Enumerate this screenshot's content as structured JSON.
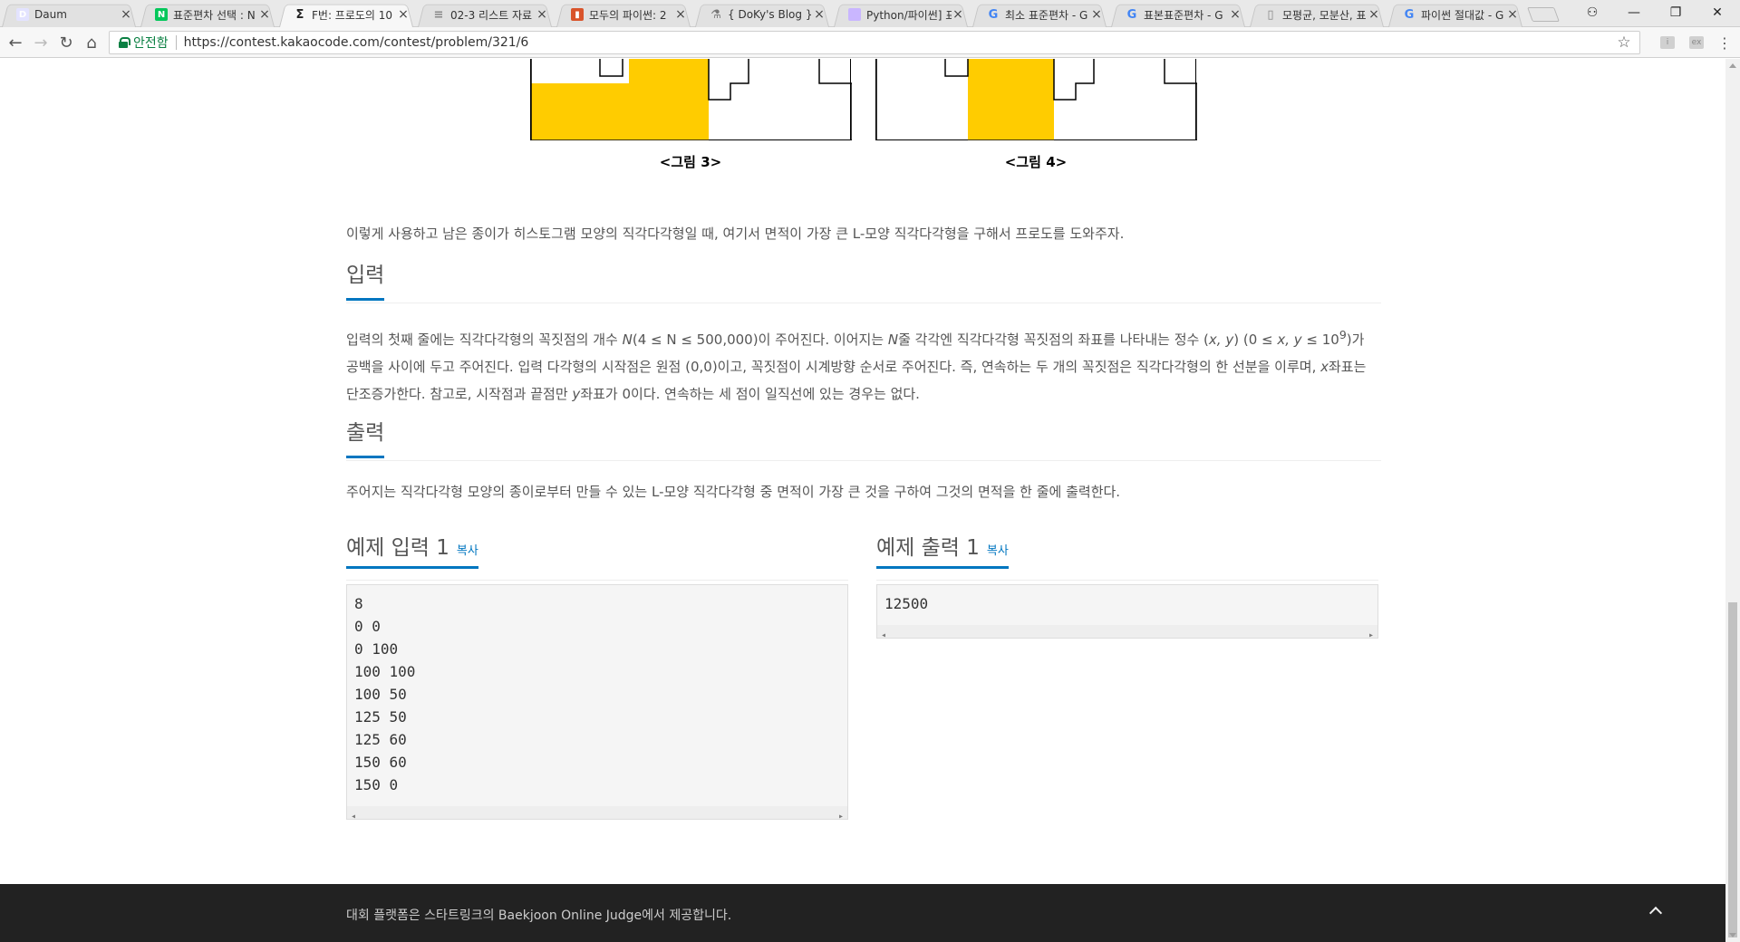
{
  "browser": {
    "tabs": [
      {
        "title": "Daum",
        "icon": "daum-icon",
        "color": "#e3e3ff"
      },
      {
        "title": "표준편차 선택 : N",
        "icon": "naver-icon",
        "color": "#03c75a"
      },
      {
        "title": "F번: 프로도의 10",
        "icon": "sigma-icon",
        "color": "#222222"
      },
      {
        "title": "02-3 리스트 자료",
        "icon": "doc-icon",
        "color": "#888888"
      },
      {
        "title": "모두의 파이썬: 2",
        "icon": "book-icon",
        "color": "#d9542b"
      },
      {
        "title": "{ DoKy's Blog } |",
        "icon": "flask-icon",
        "color": "#777777"
      },
      {
        "title": "Python/파이썬] 표",
        "icon": "gradient-icon",
        "color": "#c9b6ff"
      },
      {
        "title": "최소 표준편차 - G",
        "icon": "google-icon",
        "color": "#4285f4"
      },
      {
        "title": "표본표준편차 - G",
        "icon": "google-icon",
        "color": "#4285f4"
      },
      {
        "title": "모평균, 모분산, 표",
        "icon": "page-icon",
        "color": "#888888"
      },
      {
        "title": "파이썬 절대값 - G",
        "icon": "google-icon",
        "color": "#4285f4"
      }
    ],
    "active_tab": 2,
    "address": {
      "secure_label": "안전함",
      "url": "https://contest.kakaocode.com/contest/problem/321/6"
    }
  },
  "figures": {
    "fig3_caption": "<그림 3>",
    "fig4_caption": "<그림 4>",
    "fill_color": "#ffcc00"
  },
  "problem": {
    "intro": "이렇게 사용하고 남은 종이가 히스토그램 모양의 직각다각형일 때, 여기서 면적이 가장 큰 L-모양 직각다각형을 구해서 프로도를 도와주자.",
    "input_heading": "입력",
    "input_text": {
      "p1": "입력의 첫째 줄에는 직각다각형의 꼭짓점의 개수 ",
      "n1": "N",
      "p2": "(4 ≤ N ≤ 500,000)이 주어진다. 이어지는 ",
      "n2": "N",
      "p3": "줄 각각엔 직각다각형 꼭짓점의 좌표를 나타내는 정수 (",
      "xy": "x, y",
      "p4": ") (0 ≤ ",
      "xy2": "x, y",
      "p5": " ≤ 10",
      "sup": "9",
      "p6": ")가 공백을 사이에 두고 주어진다. 입력 다각형의 시작점은 원점 (0,0)이고, 꼭짓점이 시계방향 순서로 주어진다. 즉, 연속하는 두 개의 꼭짓점은 직각다각형의 한 선분을 이루며, ",
      "x": "x",
      "p7": "좌표는 단조증가한다. 참고로, 시작점과 끝점만 ",
      "y": "y",
      "p8": "좌표가 0이다. 연속하는 세 점이 일직선에 있는 경우는 없다."
    },
    "output_heading": "출력",
    "output_text": "주어지는 직각다각형 모양의 종이로부터 만들 수 있는 L-모양 직각다각형 중 면적이 가장 큰 것을 구하여 그것의 면적을 한 줄에 출력한다.",
    "sample_input_title": "예제 입력 1",
    "sample_output_title": "예제 출력 1",
    "copy_label": "복사",
    "sample_input": "8\n0 0\n0 100\n100 100\n100 50\n125 50\n125 60\n150 60\n150 0",
    "sample_output": "12500"
  },
  "footer": {
    "text": "대회 플랫폼은 스타트링크의 Baekjoon Online Judge에서 제공합니다."
  }
}
